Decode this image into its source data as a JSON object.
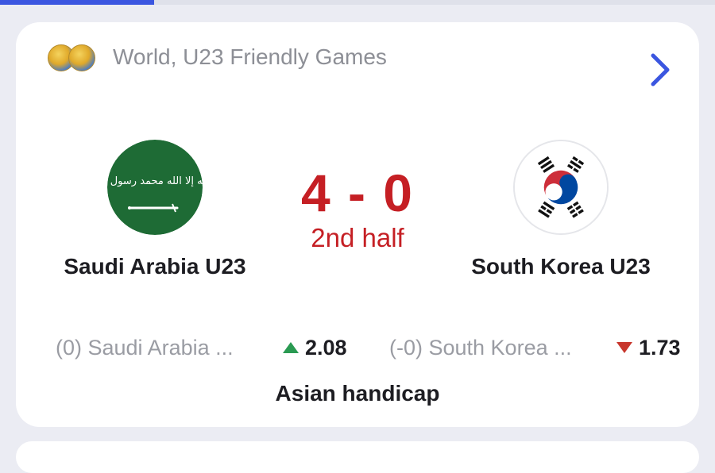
{
  "colors": {
    "accent": "#3b56e0",
    "score_red": "#c51f24",
    "odds_up": "#2a9a52",
    "odds_down": "#c8372d",
    "saudi_green": "#1e6b35"
  },
  "progress": {
    "fraction": 0.215
  },
  "league": {
    "icon": "world-cup-balls-icon",
    "name": "World, U23 Friendly Games",
    "chevron_icon": "chevron-right-icon"
  },
  "match": {
    "home": {
      "name": "Saudi Arabia U23",
      "logo_icon": "saudi-arabia-flag-icon",
      "logo_script": "لا إله إلا الله محمد رسول الله"
    },
    "away": {
      "name": "South Korea U23",
      "logo_icon": "south-korea-flag-icon"
    },
    "score": "4 - 0",
    "period": "2nd half"
  },
  "odds": {
    "market": "Asian handicap",
    "home": {
      "label": "(0) Saudi Arabia ...",
      "value": "2.08",
      "trend_icon": "arrow-up-icon"
    },
    "away": {
      "label": "(-0) South Korea ...",
      "value": "1.73",
      "trend_icon": "arrow-down-icon"
    }
  }
}
